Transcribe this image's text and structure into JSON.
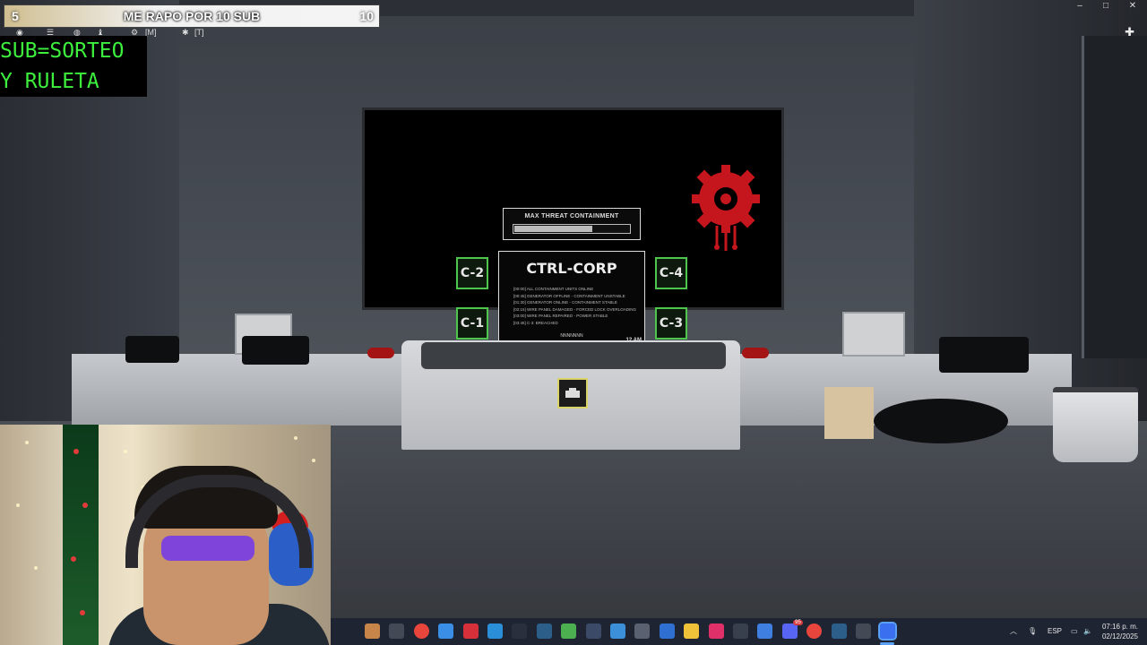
{
  "goal_bar": {
    "current": "5",
    "text": "ME RAPO POR 10 SUB",
    "target": "10"
  },
  "toolbar": {
    "items": [
      {
        "icon": "camera-icon",
        "label": ""
      },
      {
        "icon": "menu-icon",
        "label": ""
      },
      {
        "icon": "chat-icon",
        "label": ""
      },
      {
        "icon": "backpack-icon",
        "label": ""
      },
      {
        "icon": "settings-icon",
        "label": "[M]"
      },
      {
        "icon": "emote-icon",
        "label": "[T]"
      }
    ]
  },
  "promo": {
    "line1": "SUB=SORTEO",
    "line2": "Y RULETA"
  },
  "game": {
    "threat_label": "MAX THREAT CONTAINMENT",
    "threat_level": 0.68,
    "cameras": {
      "c1": "C-1",
      "c2": "C-2",
      "c3": "C-3",
      "c4": "C-4"
    },
    "terminal_title": "CTRL-CORP",
    "terminal_lines": [
      "[00:00] ALL CONTAINMENT UNITS ONLINE",
      "[00:45] GENERATOR OFFLINE - CONTAINMENT UNSTABLE",
      "[01:30] GENERATOR ONLINE - CONTAINMENT STABLE",
      "[02:15] WIRE PANEL DAMAGED - FORCED LOCK OVERLOADING",
      "[03:00] WIRE PANEL REPAIRED - POWER STABLE",
      "[03:45] C-3: BREACHED"
    ],
    "terminal_footer": "NNNNNNN",
    "terminal_time": "12 AM",
    "logo_color": "#c4161c",
    "camera_frame_color": "#4ec64e"
  },
  "window_controls": {
    "minimize": "–",
    "maximize": "□",
    "close": "✕"
  },
  "taskbar": {
    "icons": [
      "store-icon",
      "terminal-icon",
      "chrome-icon",
      "photos-icon",
      "app-red-icon",
      "edge-icon",
      "dots-icon",
      "steam-icon",
      "minecraft-icon",
      "game-icon",
      "notepad-icon",
      "calculator-icon",
      "remote-icon",
      "folder-icon",
      "tiktok-icon",
      "obs-icon",
      "vpn-icon",
      "discord-icon",
      "chrome-icon",
      "steam-icon",
      "keyboard-icon",
      "roblox-icon"
    ],
    "discord_badge": "95",
    "tray": {
      "language": "ESP"
    },
    "clock": {
      "time": "07:16 p. m.",
      "date": "02/12/2025"
    }
  }
}
